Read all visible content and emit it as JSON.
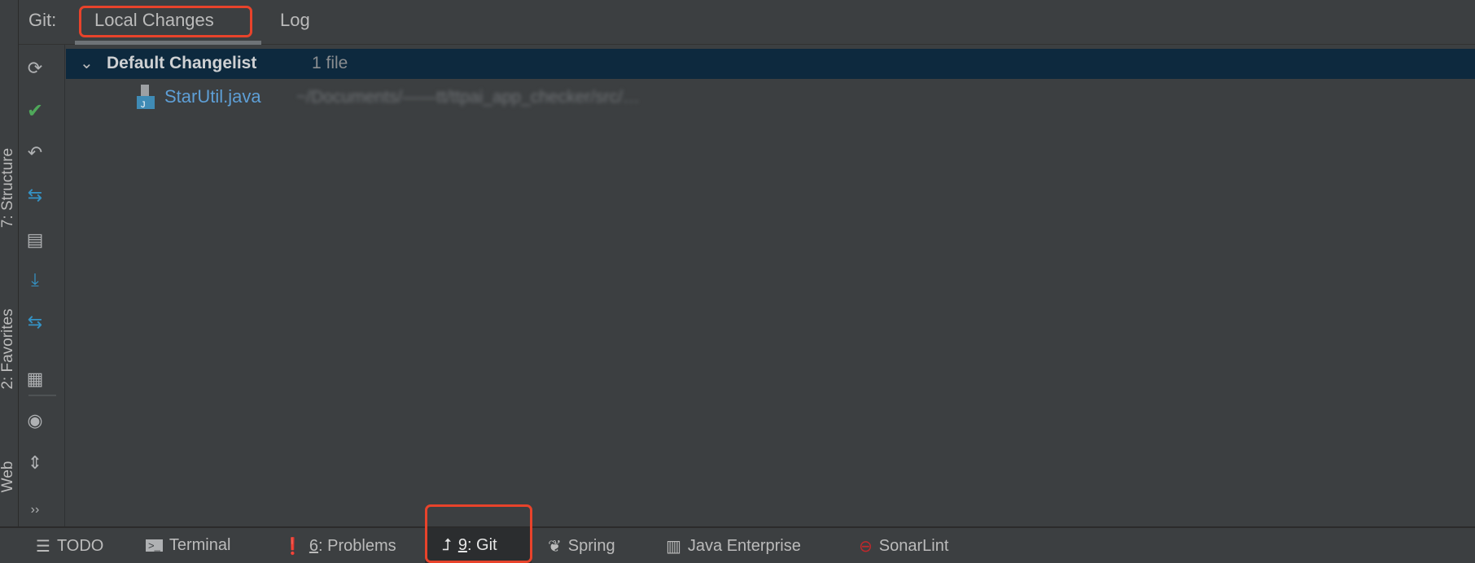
{
  "stripe": {
    "items": [
      {
        "label": "7: Structure"
      },
      {
        "label": "2: Favorites"
      },
      {
        "label": "Web"
      }
    ]
  },
  "header": {
    "prefix": "Git:",
    "tabs": [
      {
        "label": "Local Changes",
        "active": true
      },
      {
        "label": "Log",
        "active": false
      }
    ]
  },
  "toolbar": {
    "icons": [
      "refresh-icon",
      "commit-check-icon",
      "rollback-icon",
      "compare-icon",
      "changelist-icon",
      "update-icon",
      "merge-icon",
      "group-by-icon",
      "view-options-icon",
      "expand-collapse-icon",
      "more-icon"
    ],
    "more_label": "››"
  },
  "changelist": {
    "name": "Default Changelist",
    "count": "1 file",
    "files": [
      {
        "name": "StarUtil.java",
        "path": "~/Documents/——tt/ttpai_app_checker/src/…"
      }
    ]
  },
  "bottom": {
    "items": [
      {
        "label": "TODO"
      },
      {
        "label": "Terminal"
      },
      {
        "key": "6",
        "label": ": Problems"
      },
      {
        "key": "9",
        "label": ": Git",
        "active": true
      },
      {
        "label": "Spring"
      },
      {
        "label": "Java Enterprise"
      },
      {
        "label": "SonarLint"
      }
    ]
  },
  "colors": {
    "background": "#3c3f41",
    "selection": "#0d293e",
    "file_modified": "#5e9fd6",
    "highlight": "#e8432b"
  }
}
